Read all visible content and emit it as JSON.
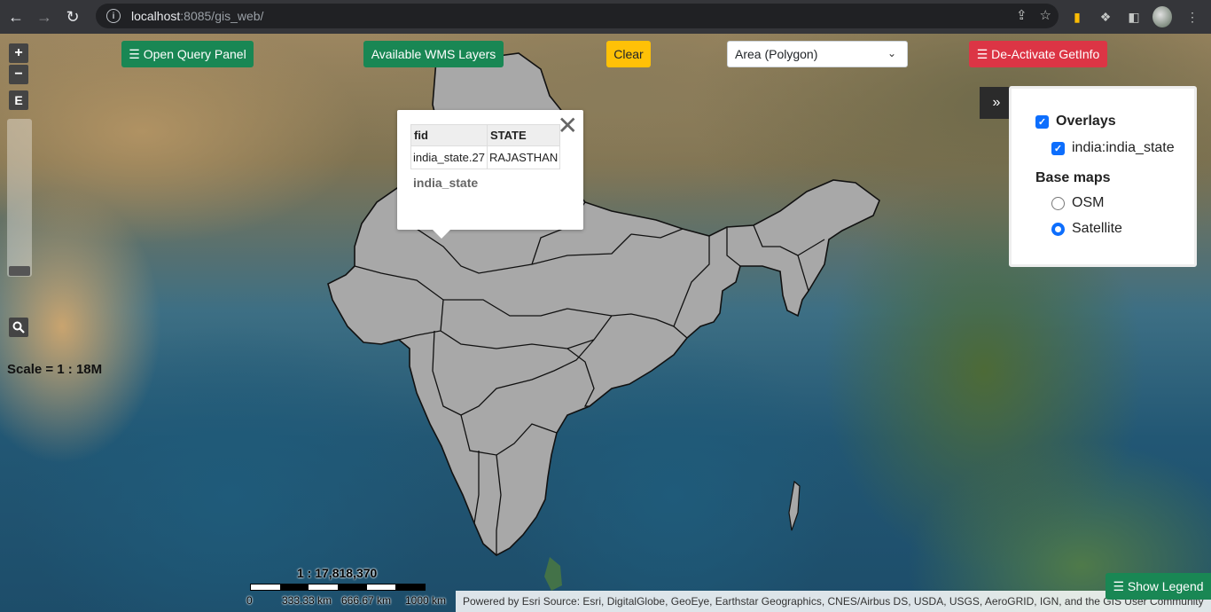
{
  "browser": {
    "url_host": "localhost",
    "url_rest": ":8085/gis_web/"
  },
  "toolbar": {
    "open_query_panel": "☰ Open Query Panel",
    "wms_layers": "Available WMS Layers",
    "clear": "Clear",
    "draw_type": "Area (Polygon)",
    "getinfo": "☰ De-Activate GetInfo"
  },
  "map_controls": {
    "zoom_in": "+",
    "zoom_out": "−",
    "extent": "E",
    "scale_text": "Scale = 1 : 18M"
  },
  "popup": {
    "headers": [
      "fid",
      "STATE"
    ],
    "row": [
      "india_state.27",
      "RAJASTHAN"
    ],
    "layer_name": "india_state",
    "close": "✕"
  },
  "layer_switcher": {
    "toggle": "»",
    "overlays_title": "Overlays",
    "overlay_layer": "india:india_state",
    "basemaps_title": "Base maps",
    "osm": "OSM",
    "satellite": "Satellite",
    "selected_basemap": "Satellite"
  },
  "scale_line": {
    "ratio": "1 : 17,818,370",
    "labels": [
      "0",
      "333.33 km",
      "666.67 km",
      "1000 km"
    ]
  },
  "attribution": "Powered by Esri Source: Esri, DigitalGlobe, GeoEye, Earthstar Geographics, CNES/Airbus DS, USDA, USGS, AeroGRID, IGN, and the GIS User Community",
  "legend_button": "☰ Show Legend"
}
